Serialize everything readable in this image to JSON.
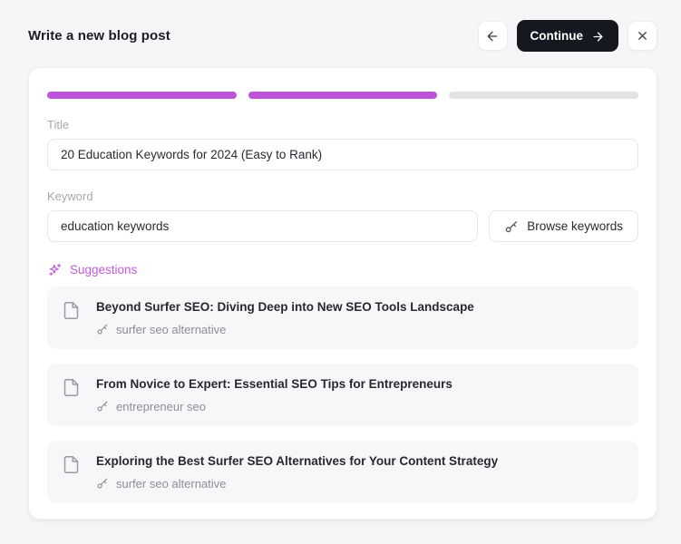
{
  "colors": {
    "accent": "#bc55d8",
    "accent_text": "#c45add",
    "dark_button": "#16181f",
    "progress_empty": "#e3e3e7",
    "page_bg": "#f6f6f8"
  },
  "header": {
    "title": "Write a new blog post",
    "continue_label": "Continue"
  },
  "progress": {
    "completed": 2,
    "total": 3
  },
  "form": {
    "title_label": "Title",
    "title_value": "20 Education Keywords for 2024 (Easy to Rank)",
    "keyword_label": "Keyword",
    "keyword_value": "education keywords",
    "browse_button_label": "Browse keywords"
  },
  "suggestions": {
    "heading": "Suggestions",
    "items": [
      {
        "title": "Beyond Surfer SEO: Diving Deep into New SEO Tools Landscape",
        "keyword": "surfer seo alternative"
      },
      {
        "title": "From Novice to Expert: Essential SEO Tips for Entrepreneurs",
        "keyword": "entrepreneur seo"
      },
      {
        "title": "Exploring the Best Surfer SEO Alternatives for Your Content Strategy",
        "keyword": "surfer seo alternative"
      }
    ]
  }
}
